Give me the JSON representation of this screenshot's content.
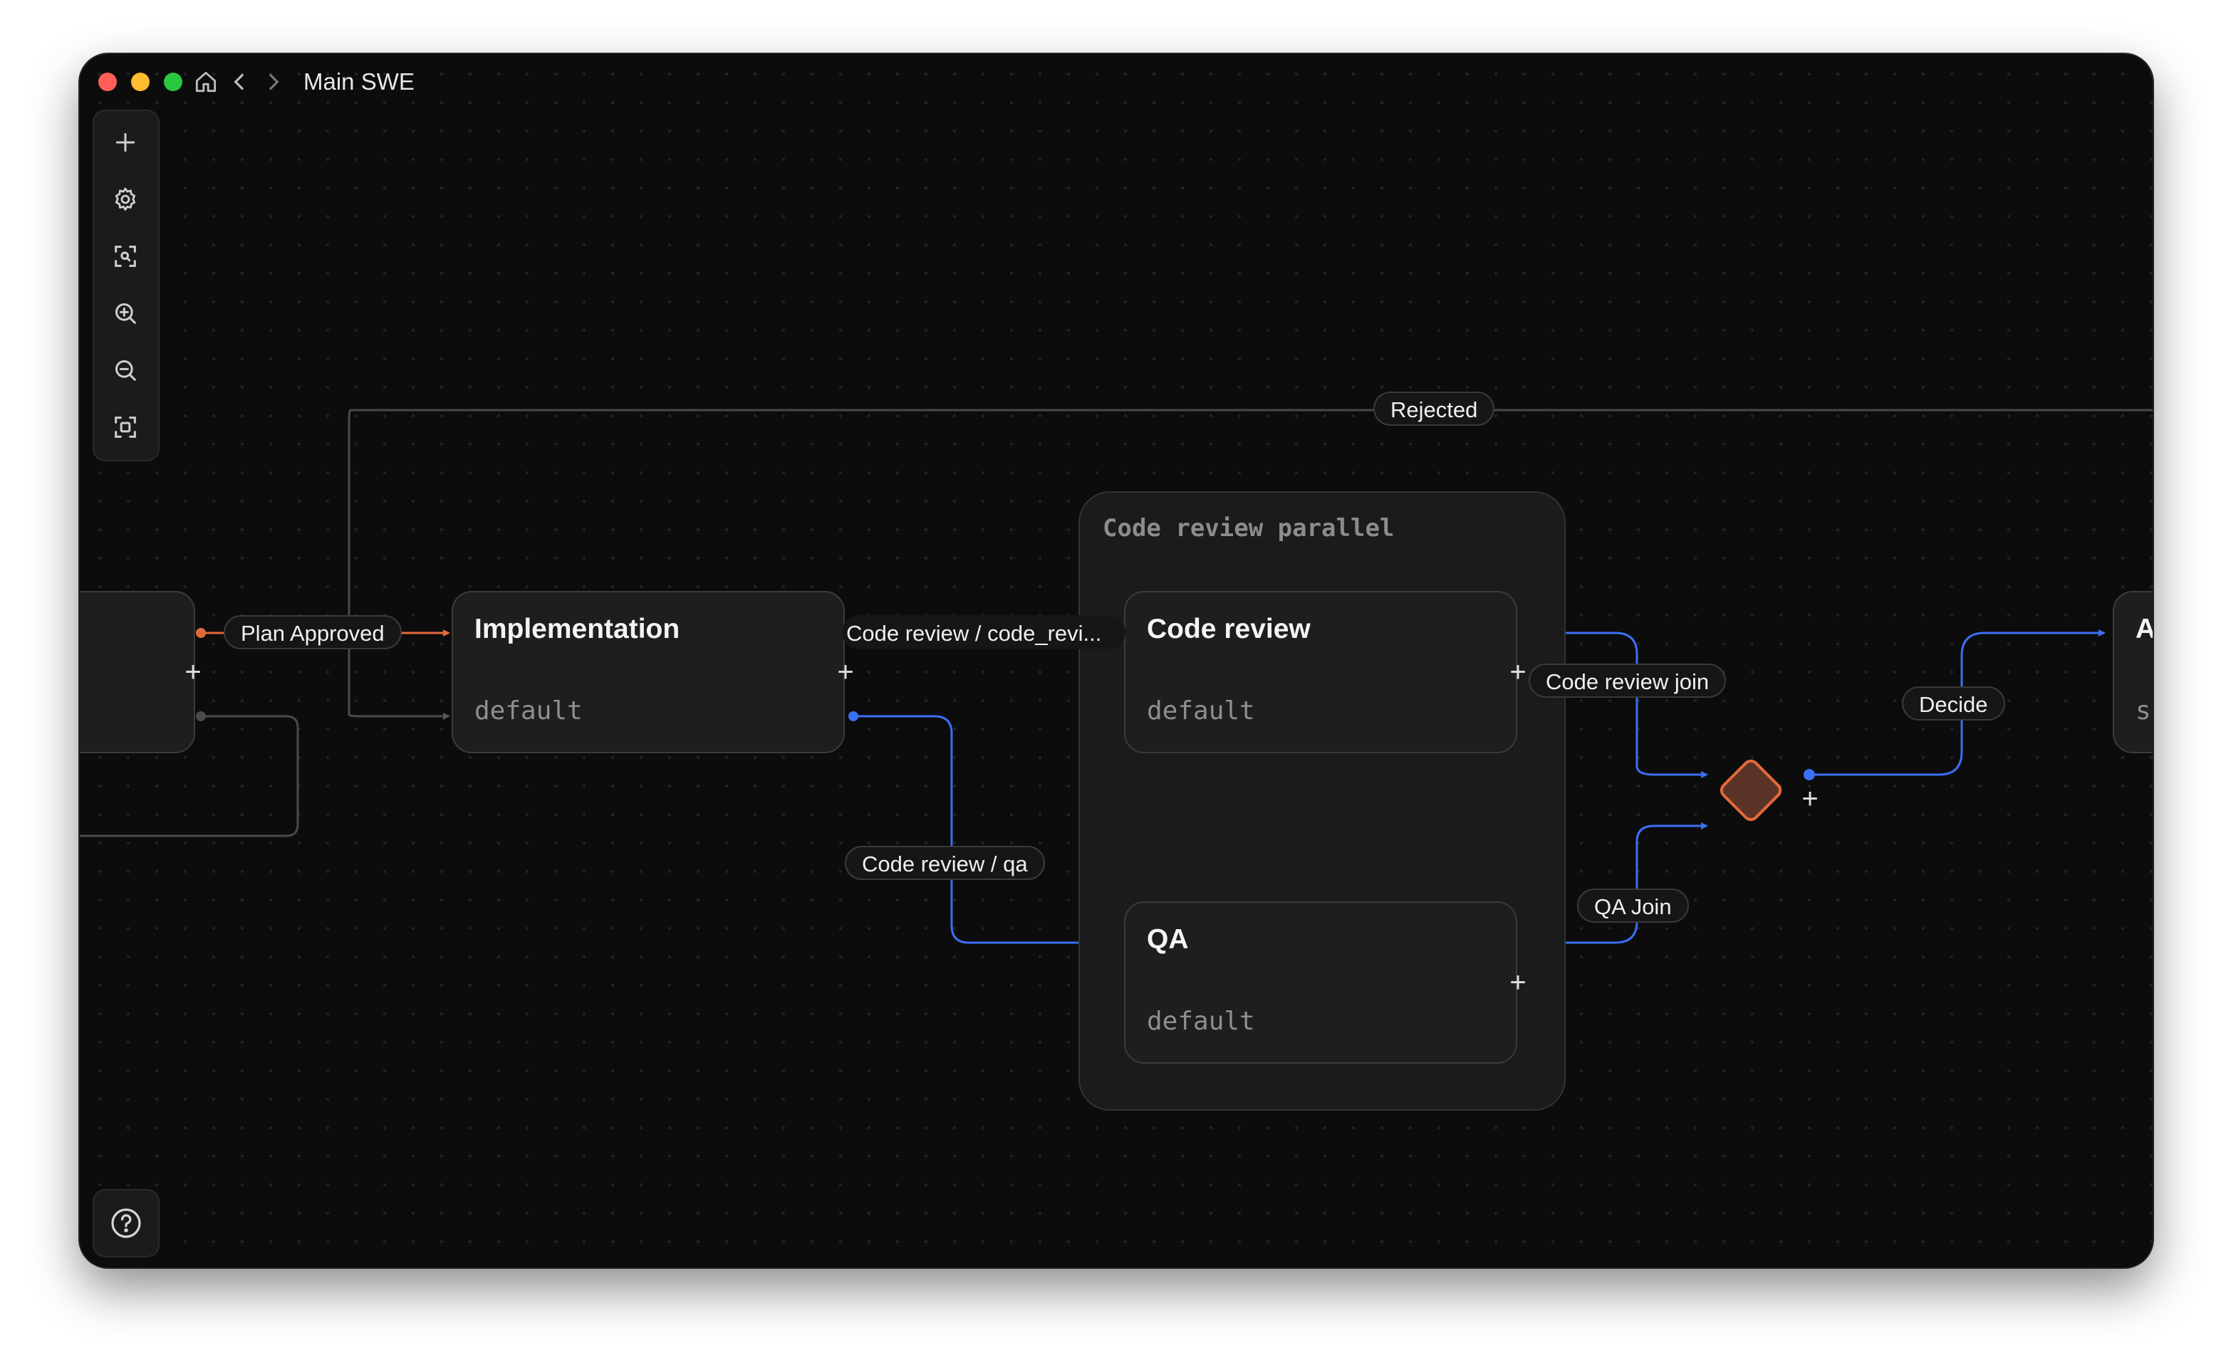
{
  "window": {
    "title": "Main SWE"
  },
  "toolbar": {
    "items": [
      {
        "icon": "plus-icon"
      },
      {
        "icon": "gear-icon"
      },
      {
        "icon": "focus-icon"
      },
      {
        "icon": "zoom-in-icon"
      },
      {
        "icon": "zoom-out-icon"
      },
      {
        "icon": "fit-view-icon"
      }
    ]
  },
  "help": {
    "icon": "help-icon"
  },
  "group": {
    "label": "Code review parallel"
  },
  "nodes": {
    "implementation": {
      "title": "Implementation",
      "subtitle": "default"
    },
    "code_review": {
      "title": "Code review",
      "subtitle": "default"
    },
    "qa": {
      "title": "QA",
      "subtitle": "default"
    },
    "right_partial": {
      "title": "A",
      "subtitle": "s"
    }
  },
  "edges": {
    "rejected": "Rejected",
    "plan_approved": "Plan Approved",
    "code_review_code": "Code review / code_revi...",
    "code_review_qa": "Code review / qa",
    "code_review_join": "Code review join",
    "qa_join": "QA Join",
    "decide": "Decide"
  },
  "colors": {
    "accent_blue": "#3b6ff5",
    "accent_orange": "#e26a3a",
    "edge_gray": "#4a4a4a",
    "canvas_bg": "#0c0c0c"
  }
}
